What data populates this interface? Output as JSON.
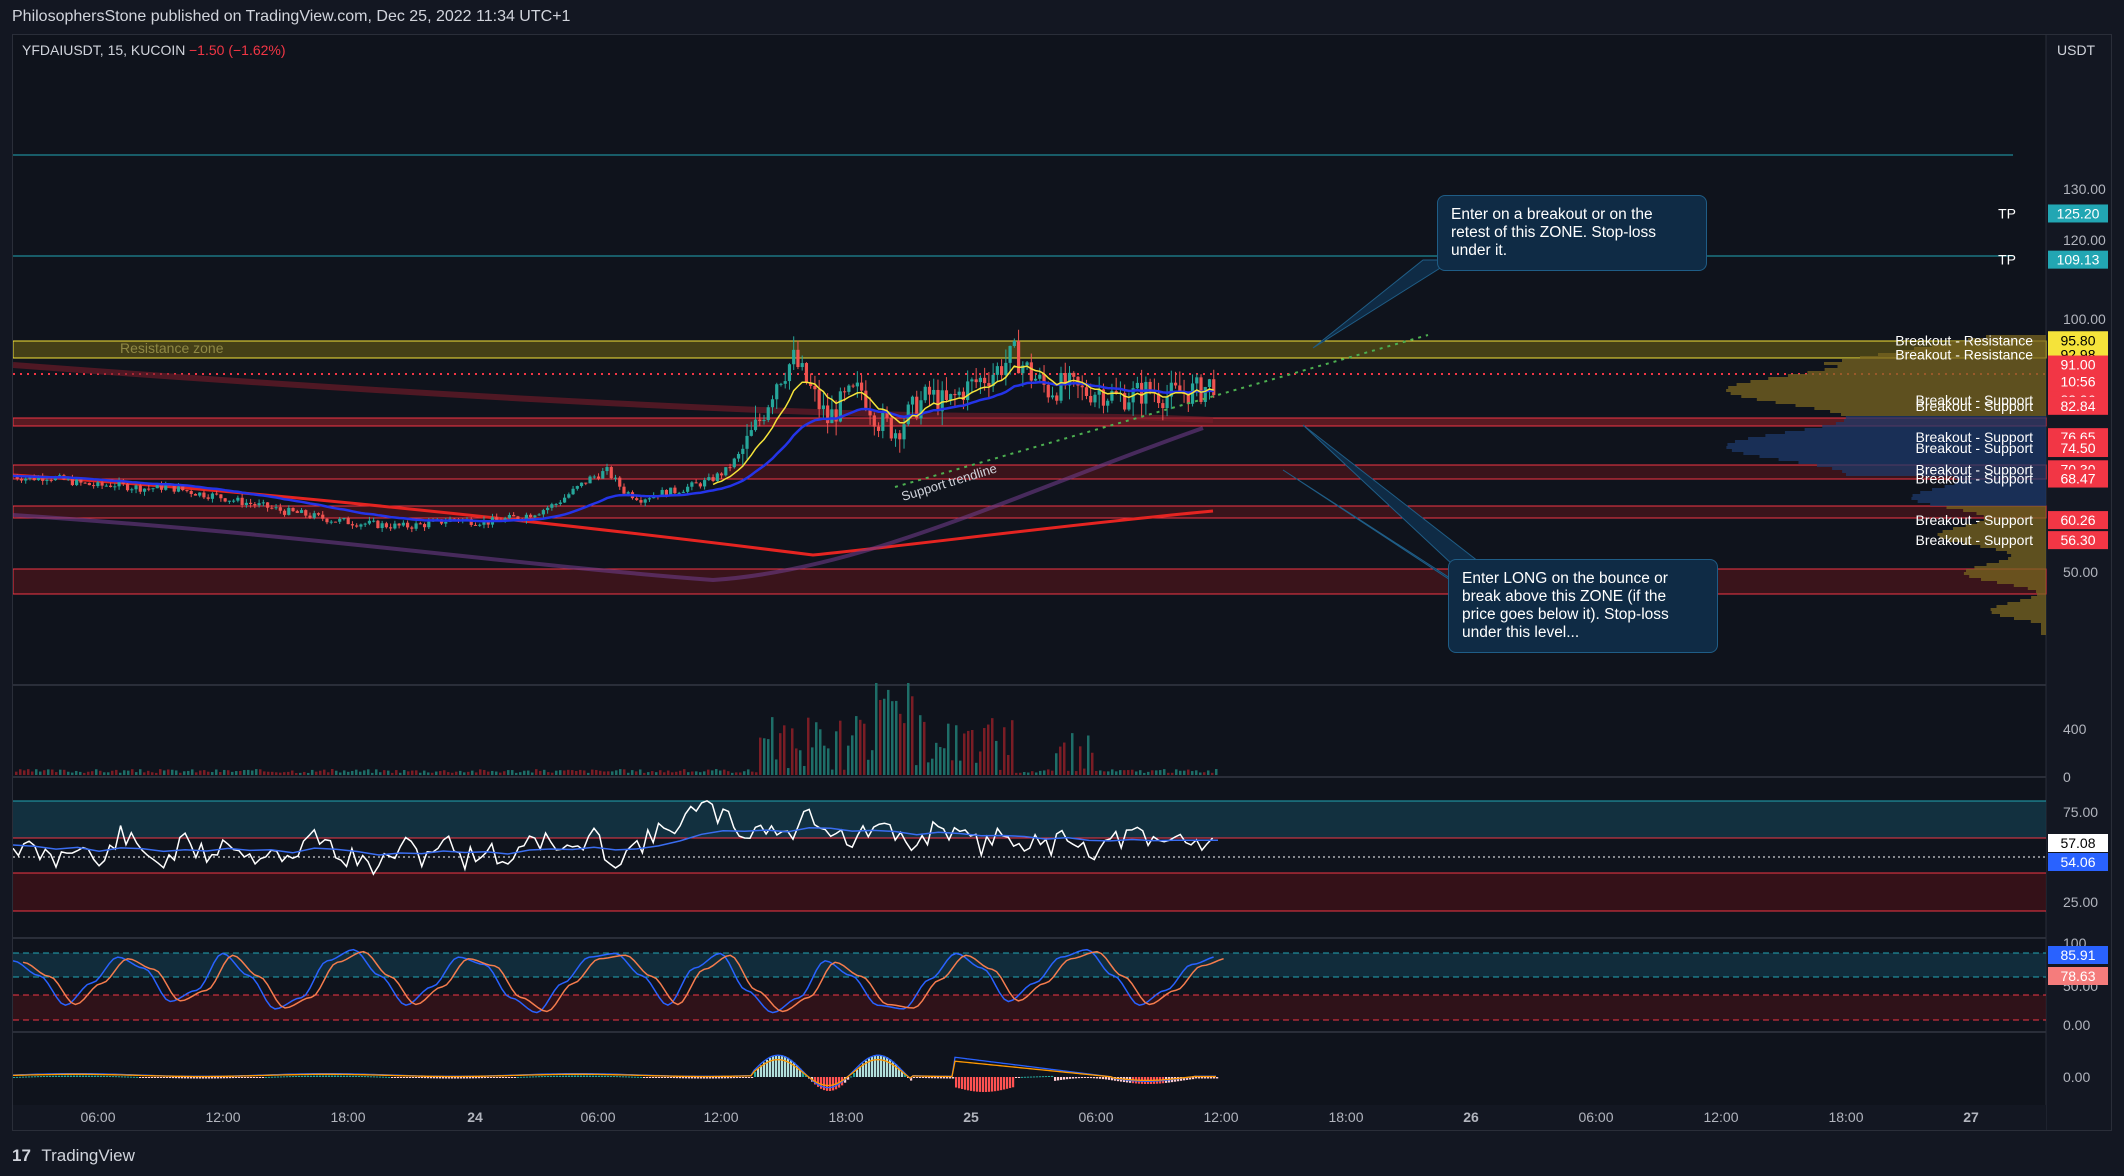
{
  "header": {
    "publish_line": "PhilosophersStone published on TradingView.com, Dec 25, 2022 11:34 UTC+1"
  },
  "symbol": {
    "name": "YFDAIUSDT, 15, KUCOIN",
    "change": "−1.50 (−1.62%)"
  },
  "currency": "USDT",
  "footer": {
    "logo": "17",
    "brand": "TradingView"
  },
  "colors": {
    "up": "#26a69a",
    "down": "#ef5350",
    "bg": "#131722",
    "resistance": "#f5e33a",
    "support": "#f23645",
    "tp": "#22a6b3"
  },
  "callouts": {
    "top": "Enter on a breakout or on the retest of this ZONE. Stop-loss under it.",
    "bottom": "Enter LONG on the bounce or break above this ZONE (if the price goes below it). Stop-loss under this level..."
  },
  "labels": {
    "resistance_zone": "Resistance zone",
    "support_trendline": "Support trendline"
  },
  "chart_data": [
    {
      "type": "candlestick",
      "pane": "price",
      "y_ticks": [
        "130.00",
        "120.00",
        "100.00",
        "50.00"
      ],
      "ylim": [
        40,
        140
      ],
      "x_ticks": [
        "06:00",
        "12:00",
        "18:00",
        "24",
        "06:00",
        "12:00",
        "18:00",
        "25",
        "06:00",
        "12:00",
        "18:00",
        "26",
        "06:00",
        "12:00",
        "18:00",
        "27"
      ],
      "current_price": "91.00",
      "countdown": "10:56",
      "price_levels": [
        {
          "label": "TP",
          "value": "125.20",
          "color": "#22a6b3"
        },
        {
          "label": "TP",
          "value": "109.13",
          "color": "#22a6b3"
        },
        {
          "label": "Breakout - Resistance",
          "value": "95.80",
          "color": "#f5e33a"
        },
        {
          "label": "Breakout - Resistance",
          "value": "92.98",
          "color": "#f5e33a"
        },
        {
          "label": "Breakout - Support",
          "value": "83.96",
          "color": "#f23645"
        },
        {
          "label": "Breakout - Support",
          "value": "82.84",
          "color": "#f23645"
        },
        {
          "label": "Breakout - Support",
          "value": "76.65",
          "color": "#f23645"
        },
        {
          "label": "Breakout - Support",
          "value": "74.50",
          "color": "#f23645"
        },
        {
          "label": "Breakout - Support",
          "value": "70.30",
          "color": "#f23645"
        },
        {
          "label": "Breakout - Support",
          "value": "68.47",
          "color": "#f23645"
        },
        {
          "label": "Breakout - Support",
          "value": "60.26",
          "color": "#f23645"
        },
        {
          "label": "Breakout - Support",
          "value": "56.30",
          "color": "#f23645"
        }
      ],
      "price_path": [
        69,
        68.5,
        68.8,
        68.2,
        67.5,
        67,
        67.3,
        66.8,
        66.5,
        66.9,
        66.2,
        65.5,
        65,
        64.2,
        63.5,
        62.8,
        62,
        61.5,
        60.8,
        60.2,
        59.8,
        59.5,
        59.2,
        59,
        59.3,
        59.8,
        60.5,
        60.1,
        59.9,
        60.4,
        61,
        62,
        63.5,
        66,
        68.5,
        70,
        66,
        64.5,
        65.5,
        66,
        67,
        68,
        70,
        74,
        80,
        88,
        92,
        86,
        80,
        84,
        86,
        80,
        78,
        82,
        85,
        83,
        86,
        88,
        90,
        93,
        89,
        86,
        87,
        85.5,
        86,
        84.5,
        85,
        86,
        84.8,
        85.5,
        86,
        88
      ]
    },
    {
      "type": "bar",
      "pane": "volume",
      "y_ticks": [
        "400",
        "0"
      ],
      "ylim": [
        0,
        500
      ]
    },
    {
      "type": "line",
      "pane": "rsi",
      "y_ticks": [
        "75.00",
        "25.00"
      ],
      "ylim": [
        10,
        90
      ],
      "values_shown": [
        "57.08",
        "54.06"
      ],
      "rsi_path": [
        55,
        52,
        48,
        57,
        45,
        60,
        52,
        47,
        56,
        50,
        58,
        49,
        54,
        46,
        62,
        51,
        48,
        44,
        55,
        50,
        57,
        49,
        53,
        47,
        60,
        55,
        52,
        58,
        48,
        55,
        60,
        66,
        72,
        68,
        60,
        64,
        58,
        70,
        62,
        56,
        63,
        59,
        54,
        65,
        58,
        55,
        60,
        57,
        53,
        61,
        52,
        56,
        60,
        55,
        58,
        57,
        57.08
      ]
    },
    {
      "type": "line",
      "pane": "stochastic_rsi",
      "y_ticks": [
        "100",
        "50.00",
        "0.00"
      ],
      "ylim": [
        0,
        100
      ],
      "values_shown": [
        "85.91",
        "78.63"
      ],
      "k_path": [
        80,
        60,
        20,
        50,
        85,
        70,
        25,
        40,
        90,
        60,
        15,
        30,
        80,
        95,
        60,
        20,
        45,
        85,
        75,
        30,
        10,
        50,
        85,
        90,
        60,
        20,
        70,
        90,
        40,
        10,
        30,
        80,
        60,
        20,
        15,
        55,
        90,
        70,
        25,
        50,
        85,
        95,
        60,
        20,
        40,
        75,
        85.91
      ]
    },
    {
      "type": "histogram",
      "pane": "macd",
      "y_ticks": [
        "0.00"
      ]
    }
  ]
}
